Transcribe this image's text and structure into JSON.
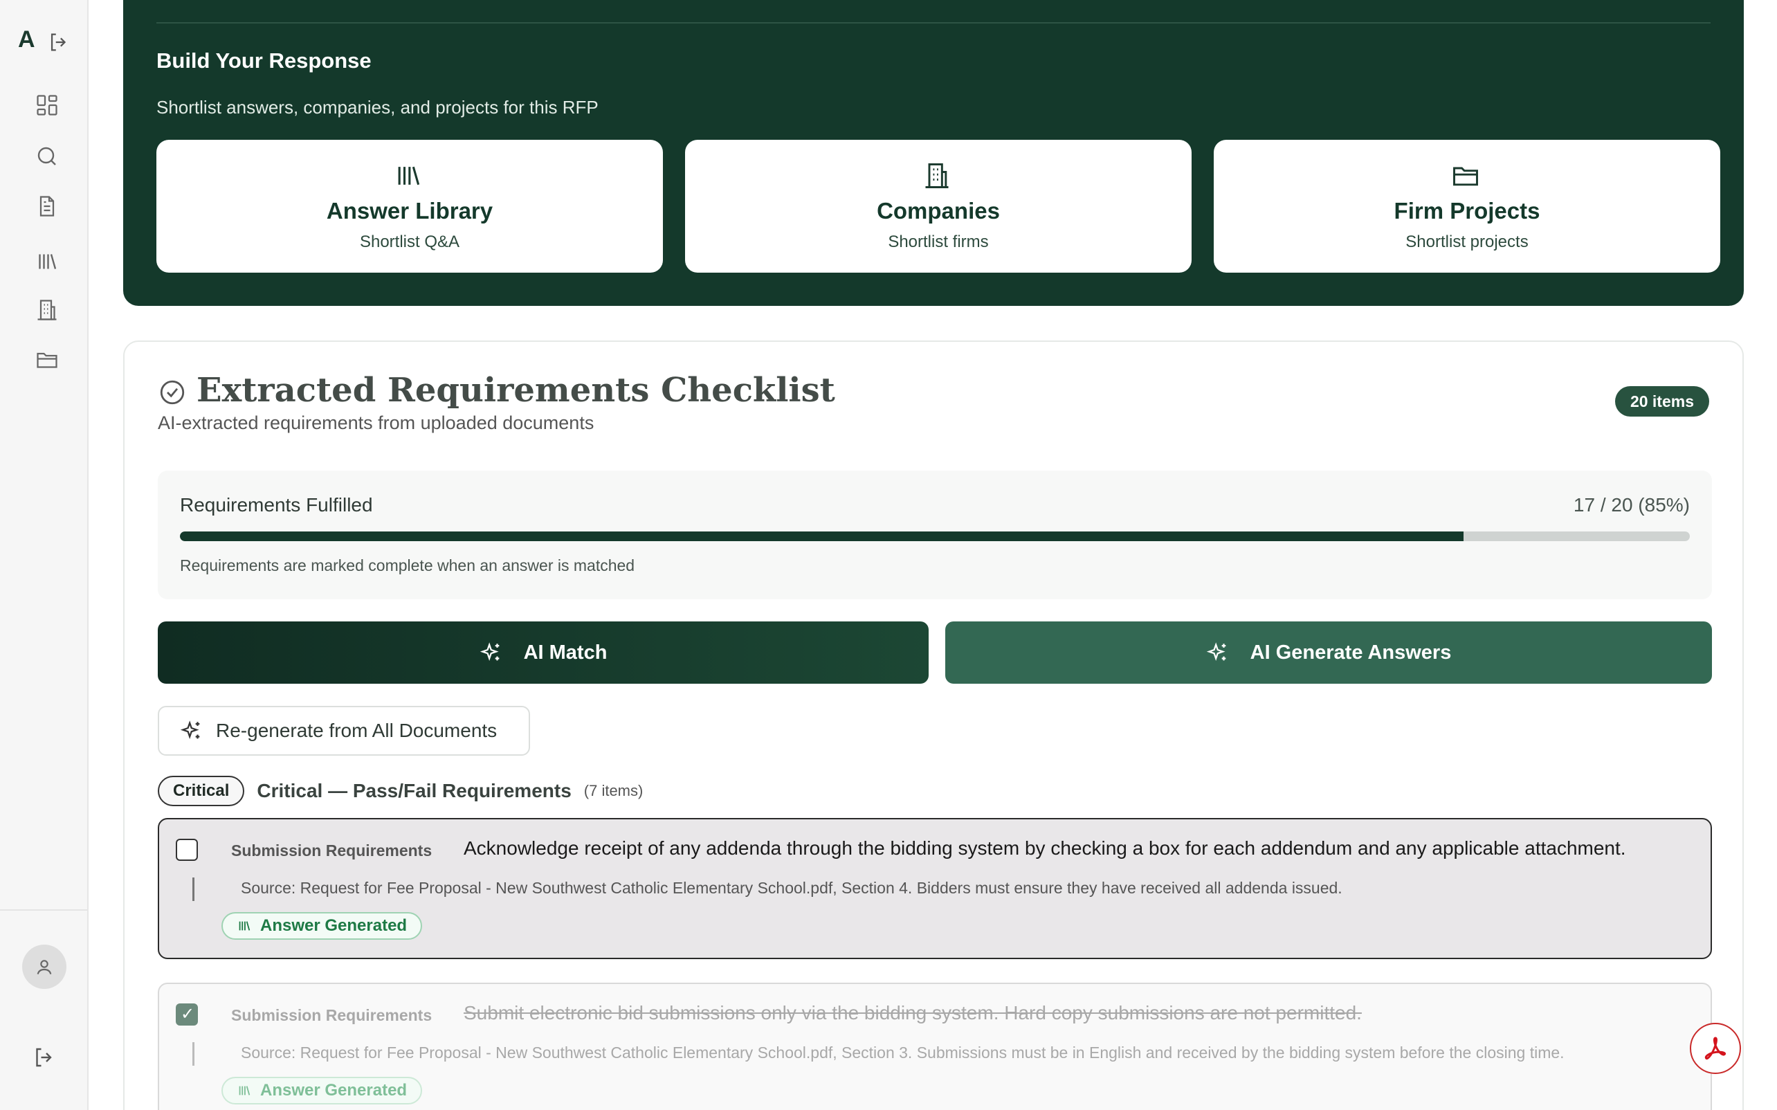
{
  "sidebar": {
    "brand": "A",
    "icons": [
      "dashboard-icon",
      "search-icon",
      "document-icon",
      "library-icon",
      "building-icon",
      "folder-icon"
    ]
  },
  "build": {
    "title": "Build Your Response",
    "subtitle": "Shortlist answers, companies, and projects for this RFP",
    "cards": [
      {
        "title": "Answer Library",
        "subtitle": "Shortlist Q&A",
        "icon": "library-icon"
      },
      {
        "title": "Companies",
        "subtitle": "Shortlist firms",
        "icon": "building-icon"
      },
      {
        "title": "Firm Projects",
        "subtitle": "Shortlist projects",
        "icon": "folder-icon"
      }
    ]
  },
  "checklist": {
    "title": "Extracted Requirements Checklist",
    "subtitle": "AI-extracted requirements from uploaded documents",
    "badge": "20 items",
    "progress": {
      "label": "Requirements Fulfilled",
      "count": "17 / 20 (85%)",
      "fraction": 0.85,
      "note": "Requirements are marked complete when an answer is matched"
    },
    "ai_match_label": "AI Match",
    "ai_generate_label": "AI Generate Answers",
    "regenerate_label": "Re-generate from All Documents",
    "section": {
      "pill": "Critical",
      "title": "Critical — Pass/Fail Requirements",
      "count": "(7 items)"
    },
    "items": [
      {
        "category": "Submission Requirements",
        "text": "Acknowledge receipt of any addenda through the bidding system by checking a box for each addendum and any applicable attachment.",
        "source": "Source: Request for Fee Proposal - New Southwest Catholic Elementary School.pdf, Section 4. Bidders must ensure they have received all addenda issued.",
        "tag": "Answer Generated",
        "checked": false
      },
      {
        "category": "Submission Requirements",
        "text": "Submit electronic bid submissions only via the bidding system. Hard copy submissions are not permitted.",
        "source": "Source: Request for Fee Proposal - New Southwest Catholic Elementary School.pdf, Section 3. Submissions must be in English and received by the bidding system before the closing time.",
        "tag": "Answer Generated",
        "checked": true
      }
    ]
  },
  "colors": {
    "primary": "#14392b",
    "accent": "#336853",
    "tag_green": "#1e7a45",
    "pdf_red": "#d4141d"
  }
}
